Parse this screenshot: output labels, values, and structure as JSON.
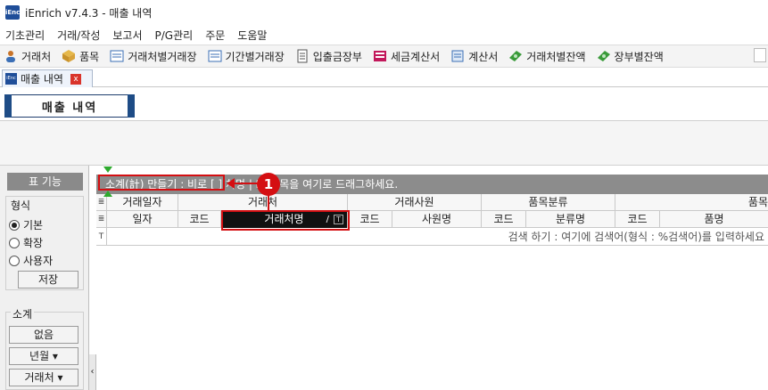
{
  "window": {
    "title": "iEnrich v7.4.3 - 매출 내역",
    "logo_text": "iEnc"
  },
  "menu": [
    "기초관리",
    "거래/작성",
    "보고서",
    "P/G관리",
    "주문",
    "도움말"
  ],
  "toolbar": [
    {
      "label": "거래처",
      "icon": "person-icon",
      "color": "#c8742a"
    },
    {
      "label": "품목",
      "icon": "box-icon",
      "color": "#d9a33a"
    },
    {
      "label": "거래처별거래장",
      "icon": "ledger-icon",
      "color": "#3b6fb6"
    },
    {
      "label": "기간별거래장",
      "icon": "ledger-icon",
      "color": "#3b6fb6"
    },
    {
      "label": "입출금장부",
      "icon": "notebook-icon",
      "color": "#555555"
    },
    {
      "label": "세금계산서",
      "icon": "invoice-icon",
      "color": "#c2185b"
    },
    {
      "label": "계산서",
      "icon": "doc-icon",
      "color": "#3b6fb6"
    },
    {
      "label": "거래처별잔액",
      "icon": "money-icon",
      "color": "#3a9a3a"
    },
    {
      "label": "장부별잔액",
      "icon": "money-icon",
      "color": "#3a9a3a"
    }
  ],
  "doc_tab": {
    "label": "매출 내역",
    "close": "x"
  },
  "page_title": "매출 내역",
  "side": {
    "header": "표 기능",
    "format_label": "형식",
    "formats": [
      {
        "label": "기본",
        "checked": true
      },
      {
        "label": "확장",
        "checked": false
      },
      {
        "label": "사용자",
        "checked": false
      }
    ],
    "save_button": "저장",
    "subtotal_label": "소계",
    "subtotal_buttons": [
      "없음",
      "년월 ▾",
      "거래처 ▾"
    ]
  },
  "grid": {
    "group_drop_text": "소계(計) 만들기 : 비로 [ ] 처명 | ☑ 🅃목을 여기로 드래그하세요.",
    "header_top": [
      "거래일자",
      "거래처",
      "거래사원",
      "품목분류",
      "품목"
    ],
    "header_bottom": [
      "일자",
      "코드",
      "거래처명",
      "코드",
      "사원명",
      "코드",
      "분류명",
      "코드",
      "품명"
    ],
    "sort_marker": "/",
    "filter_icon": "T",
    "filter_hint": "검색 하기 : 여기에 검색어(형식 : %검색어)를 입력하세요",
    "row_indicator": "≣"
  },
  "callout": {
    "number": "1",
    "color": "#d40f12"
  }
}
